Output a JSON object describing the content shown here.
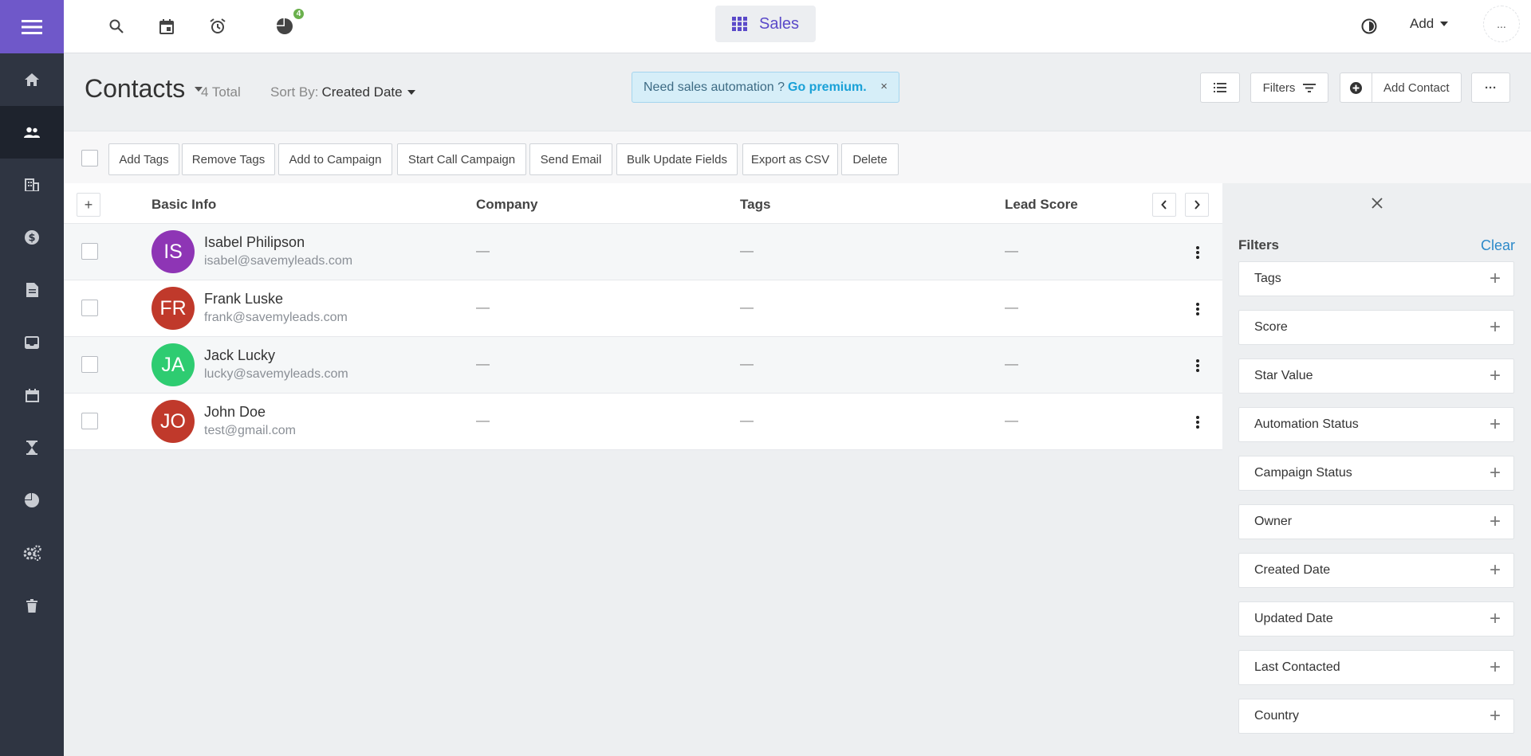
{
  "topbar": {
    "notifications_badge": "4",
    "app_name": "Sales",
    "add_label": "Add",
    "more_label": "..."
  },
  "header": {
    "title": "Contacts",
    "total": "4 Total",
    "sort_prefix": "Sort By:",
    "sort_value": "Created Date",
    "promo_text": "Need sales automation ?",
    "promo_link": "Go premium.",
    "promo_close": "×",
    "filters_label": "Filters",
    "add_contact_label": "Add Contact",
    "more_label": "···"
  },
  "bulk_actions": [
    "Add Tags",
    "Remove Tags",
    "Add to Campaign",
    "Start Call Campaign",
    "Send Email",
    "Bulk Update Fields",
    "Export as CSV",
    "Delete"
  ],
  "table": {
    "add_column": "+",
    "columns": [
      "Basic Info",
      "Company",
      "Tags",
      "Lead Score"
    ],
    "rows": [
      {
        "initials": "IS",
        "name": "Isabel Philipson",
        "email": "isabel@savemyleads.com",
        "company": "—",
        "tags": "—",
        "lead_score": "—",
        "avatar_color": "#8e35b5"
      },
      {
        "initials": "FR",
        "name": "Frank Luske",
        "email": "frank@savemyleads.com",
        "company": "—",
        "tags": "—",
        "lead_score": "—",
        "avatar_color": "#c0392b"
      },
      {
        "initials": "JA",
        "name": "Jack Lucky",
        "email": "lucky@savemyleads.com",
        "company": "—",
        "tags": "—",
        "lead_score": "—",
        "avatar_color": "#2ecc71"
      },
      {
        "initials": "JO",
        "name": "John Doe",
        "email": "test@gmail.com",
        "company": "—",
        "tags": "—",
        "lead_score": "—",
        "avatar_color": "#c0392b"
      }
    ]
  },
  "filters": {
    "title": "Filters",
    "clear_label": "Clear",
    "items": [
      "Tags",
      "Score",
      "Star Value",
      "Automation Status",
      "Campaign Status",
      "Owner",
      "Created Date",
      "Updated Date",
      "Last Contacted",
      "Country"
    ],
    "expand_symbol": "+"
  },
  "colors": {
    "sidebar_bg": "#2f3542",
    "sidebar_accent": "#6f58c9",
    "app_accent": "#5b4ac9",
    "promo_link": "#1aa1d7",
    "clear_link": "#2c89c9"
  },
  "icons": {
    "sidebar": [
      "home-icon",
      "contacts-icon",
      "building-icon",
      "dollar-icon",
      "document-icon",
      "inbox-icon",
      "calendar-icon",
      "hourglass-icon",
      "pie-chart-icon",
      "gears-icon",
      "trash-icon"
    ],
    "topbar": [
      "search-icon",
      "calendar-icon",
      "alarm-clock-icon",
      "pie-chart-icon",
      "theme-toggle-icon"
    ]
  }
}
